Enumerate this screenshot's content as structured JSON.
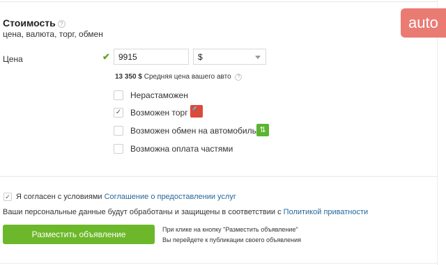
{
  "brand": {
    "text": "auto"
  },
  "price_section": {
    "title": "Стоимость",
    "help_glyph": "?",
    "subtitle": "цена, валюта, торг, обмен",
    "price_label": "Цена",
    "check_glyph": "✔",
    "price_value": "9915",
    "currency": {
      "selected": "$"
    },
    "average": {
      "value": "13 350 $",
      "text": "Средняя цена вашего авто",
      "help_glyph": "?"
    }
  },
  "options": [
    {
      "label": "Нерастаможен",
      "checked": false,
      "mark": ""
    },
    {
      "label": "Возможен торг",
      "checked": true,
      "mark": "✓",
      "icon": "auction-hammer-icon"
    },
    {
      "label": "Возможен обмен на автомобиль",
      "checked": false,
      "mark": "",
      "icon": "exchange-icon"
    },
    {
      "label": "Возможна оплата частями",
      "checked": false,
      "mark": ""
    }
  ],
  "badges": {
    "torg_glyph": "🔨",
    "exchange_glyph": "⇅"
  },
  "agreement": {
    "checked": true,
    "mark": "✓",
    "text": "Я согласен с условиями",
    "link": "Соглашение о предоставлении услуг"
  },
  "privacy": {
    "text": "Ваши персональные данные будут обработаны и защищены в соответствии с",
    "link": "Политикой приватности"
  },
  "submit": {
    "label": "Разместить объявление",
    "hint_line1": "При клике на кнопку \"Разместить объявление\"",
    "hint_line2": "Вы перейдете к публикации своего объявления"
  },
  "colors": {
    "accent_green": "#6cb82a",
    "link_blue": "#256799",
    "brand_red": "#ea7b73",
    "badge_red": "#e0473c",
    "badge_green": "#5cb531"
  }
}
